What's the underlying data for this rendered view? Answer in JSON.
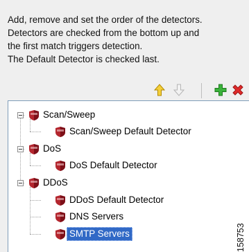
{
  "description": {
    "lines": [
      "Add, remove and set the order of the detectors.",
      "Detectors are checked from the bottom up and",
      "the first match triggers detection.",
      "The Default Detector is checked last."
    ]
  },
  "toolbar": {
    "buttons": [
      {
        "icon": "arrow-up-icon",
        "color": "#e8b400"
      },
      {
        "icon": "arrow-down-icon",
        "color": "#bdbdbd"
      },
      {
        "icon": "add-icon",
        "color": "#2e9b2e"
      },
      {
        "icon": "remove-icon",
        "color": "#d42020"
      }
    ]
  },
  "tree": {
    "items": [
      {
        "label": "Scan/Sweep",
        "level": 0
      },
      {
        "label": "Scan/Sweep Default Detector",
        "level": 1
      },
      {
        "label": "DoS",
        "level": 0
      },
      {
        "label": "DoS Default Detector",
        "level": 1
      },
      {
        "label": "DDoS",
        "level": 0
      },
      {
        "label": "DDoS Default Detector",
        "level": 1
      },
      {
        "label": "DNS Servers",
        "level": 1
      },
      {
        "label": "SMTP Servers",
        "level": 1,
        "selected": true
      }
    ]
  },
  "figure_number": "158753"
}
